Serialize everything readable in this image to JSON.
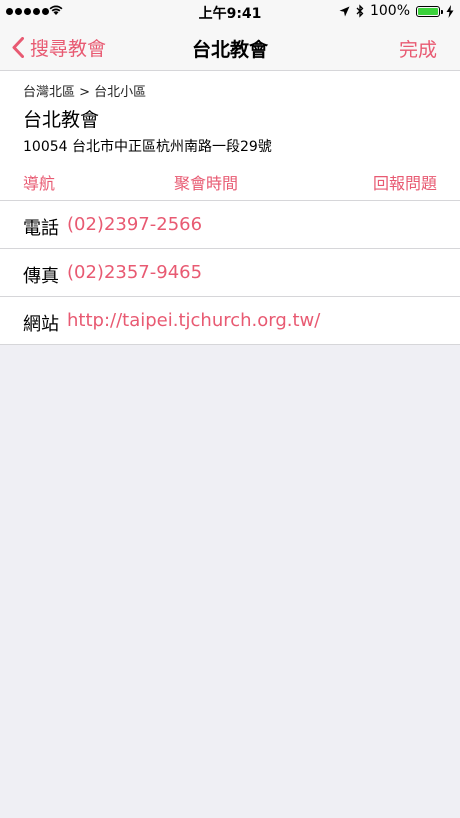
{
  "status_bar": {
    "time": "上午9:41",
    "battery": "100%",
    "battery_level": 1.0,
    "icons": [
      "signal-dots-icon",
      "wifi-icon",
      "location-arrow-icon",
      "bluetooth-icon",
      "battery-icon",
      "charging-bolt-icon"
    ]
  },
  "nav": {
    "back_label": "搜尋教會",
    "title": "台北教會",
    "done_label": "完成"
  },
  "church": {
    "breadcrumb": "台灣北區 > 台北小區",
    "name": "台北教會",
    "address": "10054 台北市中正區杭州南路一段29號"
  },
  "actions": {
    "navigate": "導航",
    "meeting_times": "聚會時間",
    "report": "回報問題"
  },
  "contact": [
    {
      "label": "電話",
      "value": "(02)2397-2566"
    },
    {
      "label": "傳真",
      "value": "(02)2357-9465"
    },
    {
      "label": "網站",
      "value": "http://taipei.tjchurch.org.tw/"
    }
  ],
  "colors": {
    "accent": "#e85a72",
    "background": "#efeff4"
  }
}
